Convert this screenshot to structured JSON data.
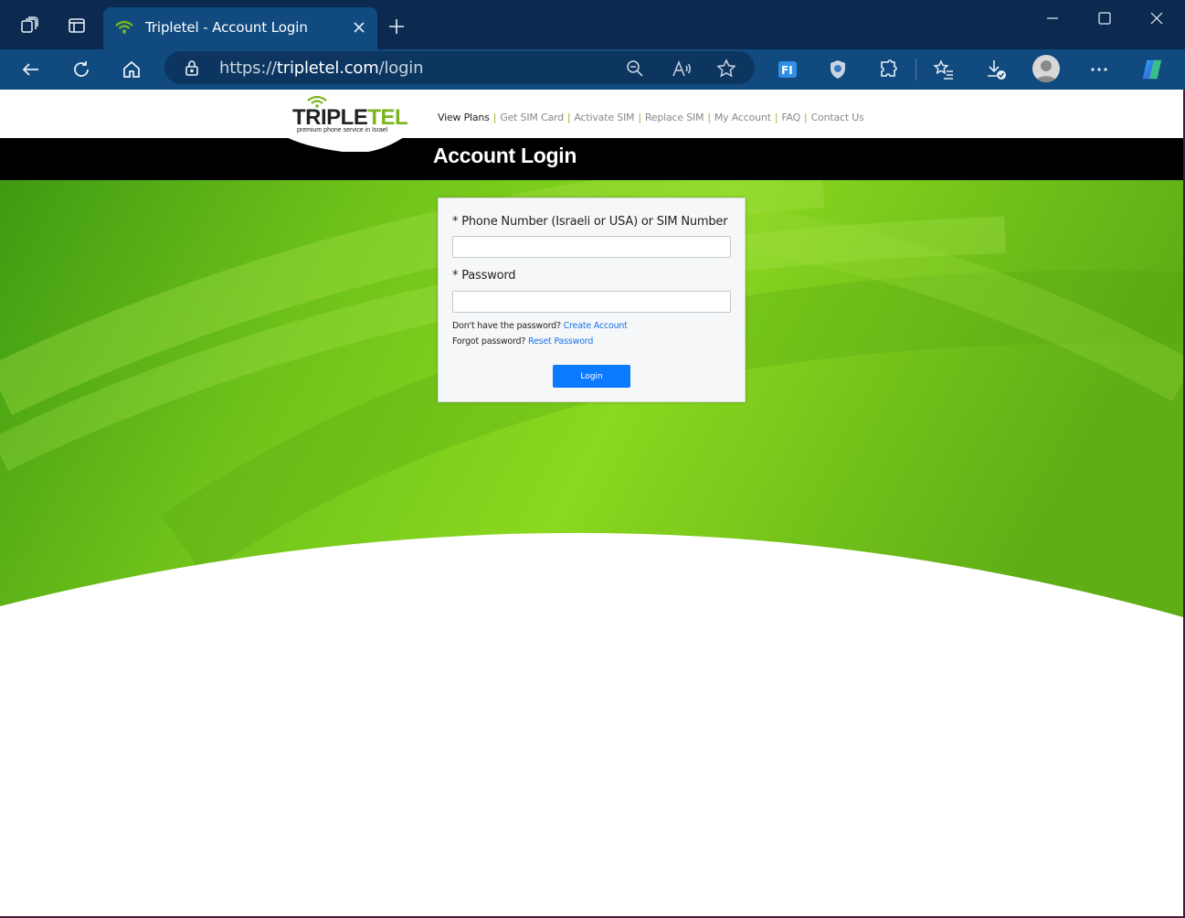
{
  "browser": {
    "tab_title": "Tripletel - Account Login",
    "url_scheme": "https://",
    "url_host": "tripletel.com",
    "url_path": "/login"
  },
  "site": {
    "logo_main": "TRIPLE",
    "logo_accent": "TEL",
    "logo_tagline": "premium phone service in Israel",
    "nav": [
      {
        "label": "View Plans"
      },
      {
        "label": "Get SIM Card"
      },
      {
        "label": "Activate SIM"
      },
      {
        "label": "Replace SIM"
      },
      {
        "label": "My Account"
      },
      {
        "label": "FAQ"
      },
      {
        "label": "Contact Us"
      }
    ],
    "page_title": "Account Login"
  },
  "login": {
    "phone_label": "* Phone Number (Israeli or USA) or SIM Number",
    "phone_value": "",
    "password_label": "* Password",
    "password_value": "",
    "no_password_text": "Don't have the password?",
    "create_account_link": "Create Account",
    "forgot_text": "Forgot password?",
    "reset_link": "Reset Password",
    "login_button": "Login"
  },
  "colors": {
    "brand_green": "#7ab51d",
    "link_blue": "#1a73e8",
    "button_blue": "#0a7bff"
  }
}
